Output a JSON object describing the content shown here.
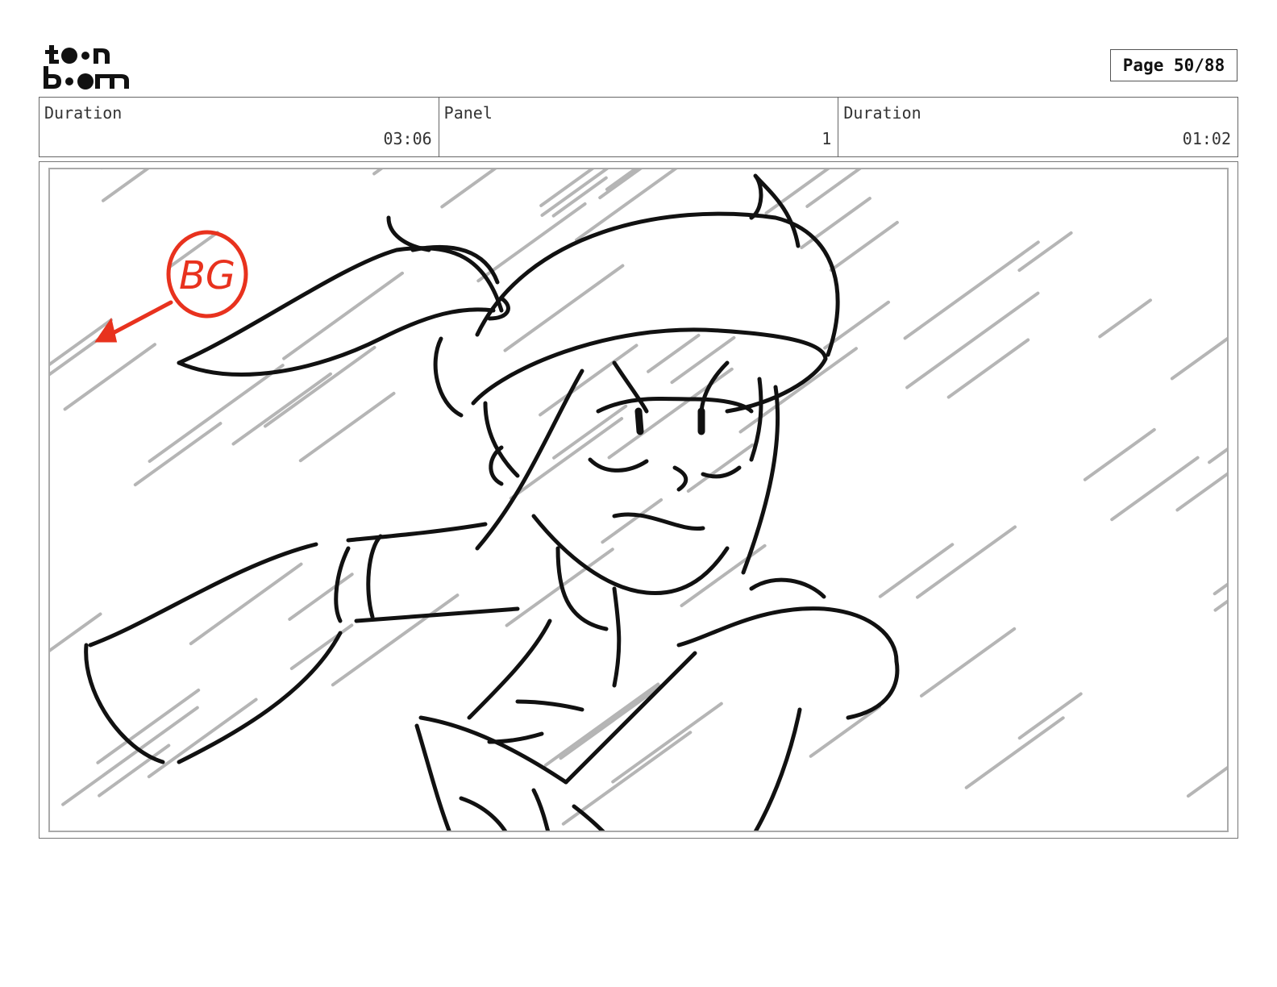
{
  "header": {
    "logo": "toon boom",
    "page_label": "Page 50/88"
  },
  "info": [
    {
      "label": "Duration",
      "value": "03:06"
    },
    {
      "label": "Panel",
      "value": "1"
    },
    {
      "label": "Duration",
      "value": "01:02"
    }
  ],
  "panel": {
    "annotation": "BG",
    "annotation_color": "#e8321e",
    "rain_color": "#b5b5b5"
  }
}
